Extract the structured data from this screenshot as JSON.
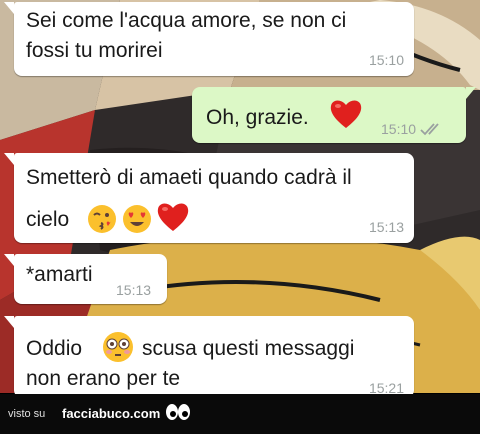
{
  "messages": [
    {
      "lines": [
        "Sei come l'acqua amore, se non ci",
        "fossi tu morirei"
      ],
      "time": "15:10",
      "direction": "incoming"
    },
    {
      "lines": [
        "Oh, grazie."
      ],
      "time": "15:10",
      "direction": "outgoing",
      "emoji": [
        "red-heart-icon"
      ],
      "status": "read-double-check-icon"
    },
    {
      "lines": [
        "Smetterò di amaeti quando cadrà il",
        "cielo"
      ],
      "time": "15:13",
      "direction": "incoming",
      "emoji": [
        "kissing-face-icon",
        "heart-eyes-face-icon",
        "red-heart-icon"
      ]
    },
    {
      "lines": [
        "*amarti"
      ],
      "time": "15:13",
      "direction": "incoming"
    },
    {
      "lines": [
        "Oddio",
        "scusa questi messaggi",
        "non erano per te"
      ],
      "time": "15:21",
      "direction": "incoming",
      "emoji": [
        "flushed-face-icon"
      ]
    }
  ],
  "footer": {
    "visto": "visto su",
    "brand": "facciabuco.com"
  },
  "colors": {
    "incoming_bubble": "#ffffff",
    "outgoing_bubble": "#dcf8c6",
    "timestamp": "#9aa0a0",
    "footer_bg": "#0a0a0a"
  }
}
